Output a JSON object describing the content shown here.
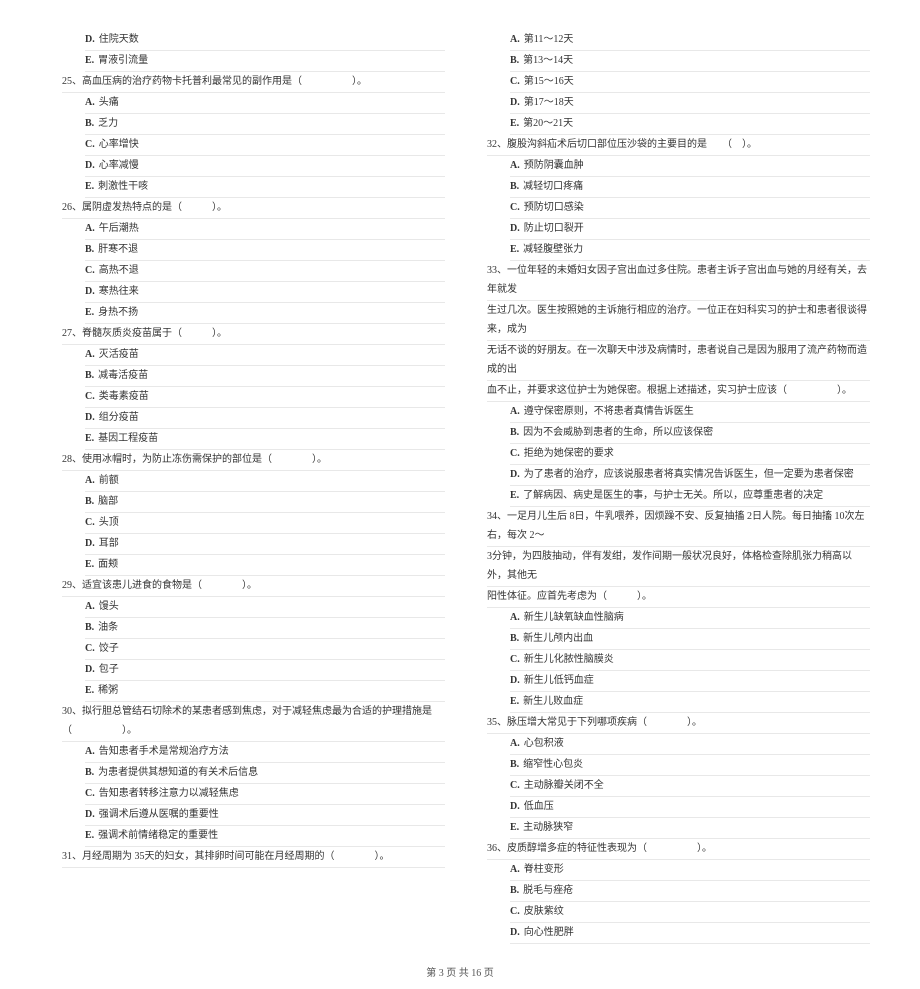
{
  "left_column": [
    {
      "type": "option",
      "letter": "D",
      "text": "住院天数"
    },
    {
      "type": "option",
      "letter": "E",
      "text": "胃液引流量"
    },
    {
      "type": "question",
      "num": "25",
      "text": "高血压病的治疗药物卡托普利最常见的副作用是（　　　　　）。"
    },
    {
      "type": "option",
      "letter": "A",
      "text": "头痛"
    },
    {
      "type": "option",
      "letter": "B",
      "text": "乏力"
    },
    {
      "type": "option",
      "letter": "C",
      "text": "心率增快"
    },
    {
      "type": "option",
      "letter": "D",
      "text": "心率减慢"
    },
    {
      "type": "option",
      "letter": "E",
      "text": "刺激性干咳"
    },
    {
      "type": "question",
      "num": "26",
      "text": "属阴虚发热特点的是（　　　）。"
    },
    {
      "type": "option",
      "letter": "A",
      "text": "午后潮热"
    },
    {
      "type": "option",
      "letter": "B",
      "text": "肝寒不退"
    },
    {
      "type": "option",
      "letter": "C",
      "text": "高热不退"
    },
    {
      "type": "option",
      "letter": "D",
      "text": "寒热往来"
    },
    {
      "type": "option",
      "letter": "E",
      "text": "身热不扬"
    },
    {
      "type": "question",
      "num": "27",
      "text": "脊髓灰质炎疫苗属于（　　　）。"
    },
    {
      "type": "option",
      "letter": "A",
      "text": "灭活疫苗"
    },
    {
      "type": "option",
      "letter": "B",
      "text": "减毒活疫苗"
    },
    {
      "type": "option",
      "letter": "C",
      "text": "类毒素疫苗"
    },
    {
      "type": "option",
      "letter": "D",
      "text": "组分疫苗"
    },
    {
      "type": "option",
      "letter": "E",
      "text": "基因工程疫苗"
    },
    {
      "type": "question",
      "num": "28",
      "text": "使用冰帽时，为防止冻伤需保护的部位是（　　　　）。"
    },
    {
      "type": "option",
      "letter": "A",
      "text": "前额"
    },
    {
      "type": "option",
      "letter": "B",
      "text": "脑部"
    },
    {
      "type": "option",
      "letter": "C",
      "text": "头顶"
    },
    {
      "type": "option",
      "letter": "D",
      "text": "耳部"
    },
    {
      "type": "option",
      "letter": "E",
      "text": "面颊"
    },
    {
      "type": "question",
      "num": "29",
      "text": "适宜该患儿进食的食物是（　　　　）。"
    },
    {
      "type": "option",
      "letter": "A",
      "text": "馒头"
    },
    {
      "type": "option",
      "letter": "B",
      "text": "油条"
    },
    {
      "type": "option",
      "letter": "C",
      "text": "饺子"
    },
    {
      "type": "option",
      "letter": "D",
      "text": "包子"
    },
    {
      "type": "option",
      "letter": "E",
      "text": "稀粥"
    },
    {
      "type": "question",
      "num": "30",
      "text": "拟行胆总管结石切除术的某患者感到焦虑，对于减轻焦虑最为合适的护理措施是（　　　　　）。"
    },
    {
      "type": "option",
      "letter": "A",
      "text": "告知患者手术是常规治疗方法"
    },
    {
      "type": "option",
      "letter": "B",
      "text": "为患者提供其想知道的有关术后信息"
    },
    {
      "type": "option",
      "letter": "C",
      "text": "告知患者转移注意力以减轻焦虑"
    },
    {
      "type": "option",
      "letter": "D",
      "text": "强调术后遵从医嘱的重要性"
    },
    {
      "type": "option",
      "letter": "E",
      "text": "强调术前情绪稳定的重要性"
    },
    {
      "type": "question",
      "num": "31",
      "text": "月经周期为 35天的妇女，其排卵时间可能在月经周期的（　　　　）。"
    }
  ],
  "right_column": [
    {
      "type": "option",
      "letter": "A",
      "text": "第11～12天"
    },
    {
      "type": "option",
      "letter": "B",
      "text": "第13～14天"
    },
    {
      "type": "option",
      "letter": "C",
      "text": "第15～16天"
    },
    {
      "type": "option",
      "letter": "D",
      "text": "第17～18天"
    },
    {
      "type": "option",
      "letter": "E",
      "text": "第20～21天"
    },
    {
      "type": "question",
      "num": "32",
      "text": "腹股沟斜疝术后切口部位压沙袋的主要目的是　　（　）。"
    },
    {
      "type": "option",
      "letter": "A",
      "text": "预防阴囊血肿"
    },
    {
      "type": "option",
      "letter": "B",
      "text": "减轻切口疼痛"
    },
    {
      "type": "option",
      "letter": "C",
      "text": "预防切口感染"
    },
    {
      "type": "option",
      "letter": "D",
      "text": "防止切口裂开"
    },
    {
      "type": "option",
      "letter": "E",
      "text": "减轻腹壁张力"
    },
    {
      "type": "question",
      "num": "33",
      "text": "一位年轻的未婚妇女因子宫出血过多住院。患者主诉子宫出血与她的月经有关，去年就发"
    },
    {
      "type": "continuation",
      "text": "生过几次。医生按照她的主诉施行相应的治疗。一位正在妇科实习的护士和患者很谈得来，成为"
    },
    {
      "type": "continuation",
      "text": "无话不谈的好朋友。在一次聊天中涉及病情时，患者说自己是因为服用了流产药物而造成的出"
    },
    {
      "type": "continuation",
      "text": "血不止，并要求这位护士为她保密。根据上述描述，实习护士应该（　　　　　）。"
    },
    {
      "type": "option",
      "letter": "A",
      "text": "遵守保密原则，不将患者真情告诉医生"
    },
    {
      "type": "option",
      "letter": "B",
      "text": "因为不会威胁到患者的生命，所以应该保密"
    },
    {
      "type": "option",
      "letter": "C",
      "text": "拒绝为她保密的要求"
    },
    {
      "type": "option",
      "letter": "D",
      "text": "为了患者的治疗，应该说服患者将真实情况告诉医生，但一定要为患者保密"
    },
    {
      "type": "option",
      "letter": "E",
      "text": "了解病因、病史是医生的事，与护士无关。所以，应尊重患者的决定"
    },
    {
      "type": "question",
      "num": "34",
      "text": "一足月儿生后 8日，牛乳喂养，因烦躁不安、反复抽搐 2日人院。每日抽搐 10次左右，每次 2～"
    },
    {
      "type": "continuation",
      "text": "3分钟，为四肢抽动，伴有发绀，发作间期一般状况良好，体格检查除肌张力稍高以外，其他无"
    },
    {
      "type": "continuation",
      "text": "阳性体征。应首先考虑为（　　　）。"
    },
    {
      "type": "suboption",
      "letter": "A",
      "text": "新生儿缺氧缺血性脑病"
    },
    {
      "type": "suboption",
      "letter": "B",
      "text": "新生儿颅内出血"
    },
    {
      "type": "suboption",
      "letter": "C",
      "text": "新生儿化脓性脑膜炎"
    },
    {
      "type": "suboption",
      "letter": "D",
      "text": "新生儿低钙血症"
    },
    {
      "type": "suboption",
      "letter": "E",
      "text": "新生儿败血症"
    },
    {
      "type": "question",
      "num": "35",
      "text": "脉压增大常见于下列哪项疾病（　　　　）。"
    },
    {
      "type": "option",
      "letter": "A",
      "text": "心包积液"
    },
    {
      "type": "option",
      "letter": "B",
      "text": "缩窄性心包炎"
    },
    {
      "type": "option",
      "letter": "C",
      "text": "主动脉瓣关闭不全"
    },
    {
      "type": "option",
      "letter": "D",
      "text": "低血压"
    },
    {
      "type": "option",
      "letter": "E",
      "text": "主动脉狭窄"
    },
    {
      "type": "question",
      "num": "36",
      "text": "皮质醇增多症的特征性表现为（　　　　　）。"
    },
    {
      "type": "option",
      "letter": "A",
      "text": "脊柱变形"
    },
    {
      "type": "option",
      "letter": "B",
      "text": "脱毛与痤疮"
    },
    {
      "type": "option",
      "letter": "C",
      "text": "皮肤紫纹"
    },
    {
      "type": "option",
      "letter": "D",
      "text": "向心性肥胖"
    }
  ],
  "footer": "第 3 页 共 16 页"
}
